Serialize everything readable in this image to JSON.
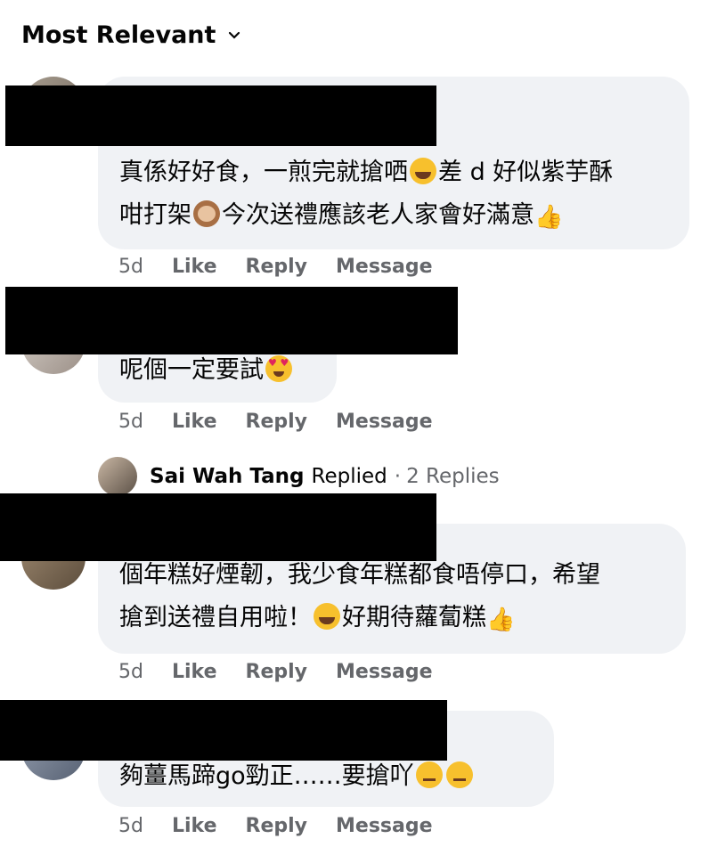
{
  "sort": {
    "label": "Most Relevant",
    "icon": "chevron-down-icon"
  },
  "comments": [
    {
      "lines": [
        "真係好好食，一煎完就搶哂",
        "差 d 好似紫芋酥",
        "咁打架",
        "今次送禮應該老人家會好滿意"
      ],
      "time": "5d",
      "like": "Like",
      "reply": "Reply",
      "message": "Message"
    },
    {
      "lines": [
        "呢個一定要試"
      ],
      "time": "5d",
      "like": "Like",
      "reply": "Reply",
      "message": "Message"
    },
    {
      "lines": [
        "個年糕好煙韌，我少食年糕都食唔停口，希望",
        "搶到送禮自用啦！",
        "好期待蘿蔔糕"
      ],
      "time": "5d",
      "like": "Like",
      "reply": "Reply",
      "message": "Message"
    },
    {
      "lines": [
        "夠薑馬蹄go勁正……要搶吖"
      ],
      "time": "5d",
      "like": "Like",
      "reply": "Reply",
      "message": "Message"
    }
  ],
  "reply_summary": {
    "name": "Sai Wah Tang",
    "action": "Replied",
    "separator": "·",
    "count": "2 Replies"
  },
  "emoji": [
    "rolling-on-floor-laughing",
    "see-no-evil-monkey",
    "thumbs-up-light-skin",
    "heart-eyes",
    "raised-eyebrow"
  ],
  "colors": {
    "bubble": "#f0f2f5",
    "muted_text": "#65676b",
    "text": "#050505",
    "redaction": "#000000"
  }
}
